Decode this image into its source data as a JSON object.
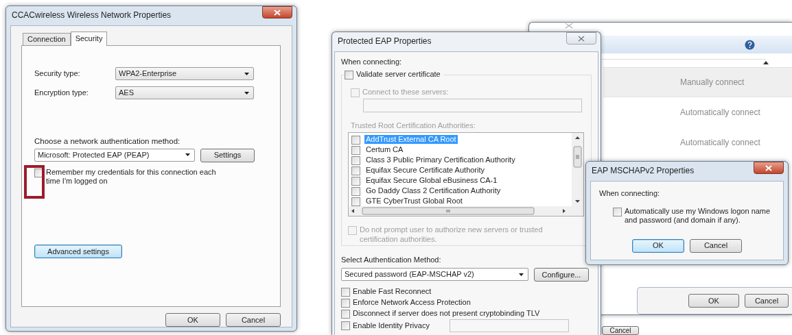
{
  "network_properties": {
    "title": "CCACwireless Wireless Network Properties",
    "tabs": [
      {
        "label": "Connection",
        "selected": false
      },
      {
        "label": "Security",
        "selected": true
      }
    ],
    "fields": [
      {
        "label": "Security type:",
        "value": "WPA2-Enterprise"
      },
      {
        "label": "Encryption type:",
        "value": "AES"
      }
    ],
    "auth_label": "Choose a network authentication method:",
    "auth_method": "Microsoft: Protected EAP (PEAP)",
    "settings_button": "Settings",
    "remember": {
      "label": "Remember my credentials for this connection each time I'm logged on",
      "checked": false,
      "highlighted": true
    },
    "advanced_button": {
      "label": "Advanced settings",
      "focused": true
    },
    "buttons": [
      {
        "label": "OK",
        "focused": false
      },
      {
        "label": "Cancel",
        "focused": false
      }
    ]
  },
  "background_window": {
    "rows": [
      {
        "status": "Manually connect",
        "selected": true
      },
      {
        "status": "Automatically connect",
        "selected": false
      },
      {
        "status": "Automatically connect",
        "selected": false
      }
    ],
    "buttons": [
      {
        "label": "OK",
        "focused": false
      },
      {
        "label": "Cancel",
        "focused": false
      }
    ],
    "behind_button": "Cancel"
  },
  "peap_properties": {
    "title": "Protected EAP Properties",
    "when_connecting": "When connecting:",
    "validate": {
      "label": "Validate server certificate",
      "checked": false,
      "disabled": false
    },
    "connect_servers": {
      "label": "Connect to these servers:",
      "checked": false,
      "disabled": true
    },
    "trusted_label": "Trusted Root Certification Authorities:",
    "certificates": [
      {
        "name": "AddTrust External CA Root",
        "checked": false,
        "selected": true
      },
      {
        "name": "Certum CA",
        "checked": false,
        "selected": false
      },
      {
        "name": "Class 3 Public Primary Certification Authority",
        "checked": false,
        "selected": false
      },
      {
        "name": "Equifax Secure Certificate Authority",
        "checked": false,
        "selected": false
      },
      {
        "name": "Equifax Secure Global eBusiness CA-1",
        "checked": false,
        "selected": false
      },
      {
        "name": "Go Daddy Class 2 Certification Authority",
        "checked": false,
        "selected": false
      },
      {
        "name": "GTE CyberTrust Global Root",
        "checked": false,
        "selected": false
      }
    ],
    "do_not_prompt": {
      "label": "Do not prompt user to authorize new servers or trusted certification authorities.",
      "checked": false,
      "disabled": true
    },
    "auth_label": "Select Authentication Method:",
    "auth_method": "Secured password (EAP-MSCHAP v2)",
    "configure_button": "Configure...",
    "options": [
      {
        "label": "Enable Fast Reconnect",
        "checked": false,
        "kind": "checkbox"
      },
      {
        "label": "Enforce Network Access Protection",
        "checked": false,
        "kind": "checkbox"
      },
      {
        "label": "Disconnect if server does not present cryptobinding TLV",
        "checked": false,
        "kind": "checkbox"
      },
      {
        "label": "Enable Identity Privacy",
        "checked": false,
        "kind": "checkbox_field"
      }
    ]
  },
  "mschapv2_properties": {
    "title": "EAP MSCHAPv2 Properties",
    "when_connecting": "When connecting:",
    "auto_logon": {
      "label": "Automatically use my Windows logon name and password (and domain if any).",
      "checked": false
    },
    "buttons": [
      {
        "label": "OK",
        "focused": true
      },
      {
        "label": "Cancel",
        "focused": false
      }
    ]
  }
}
